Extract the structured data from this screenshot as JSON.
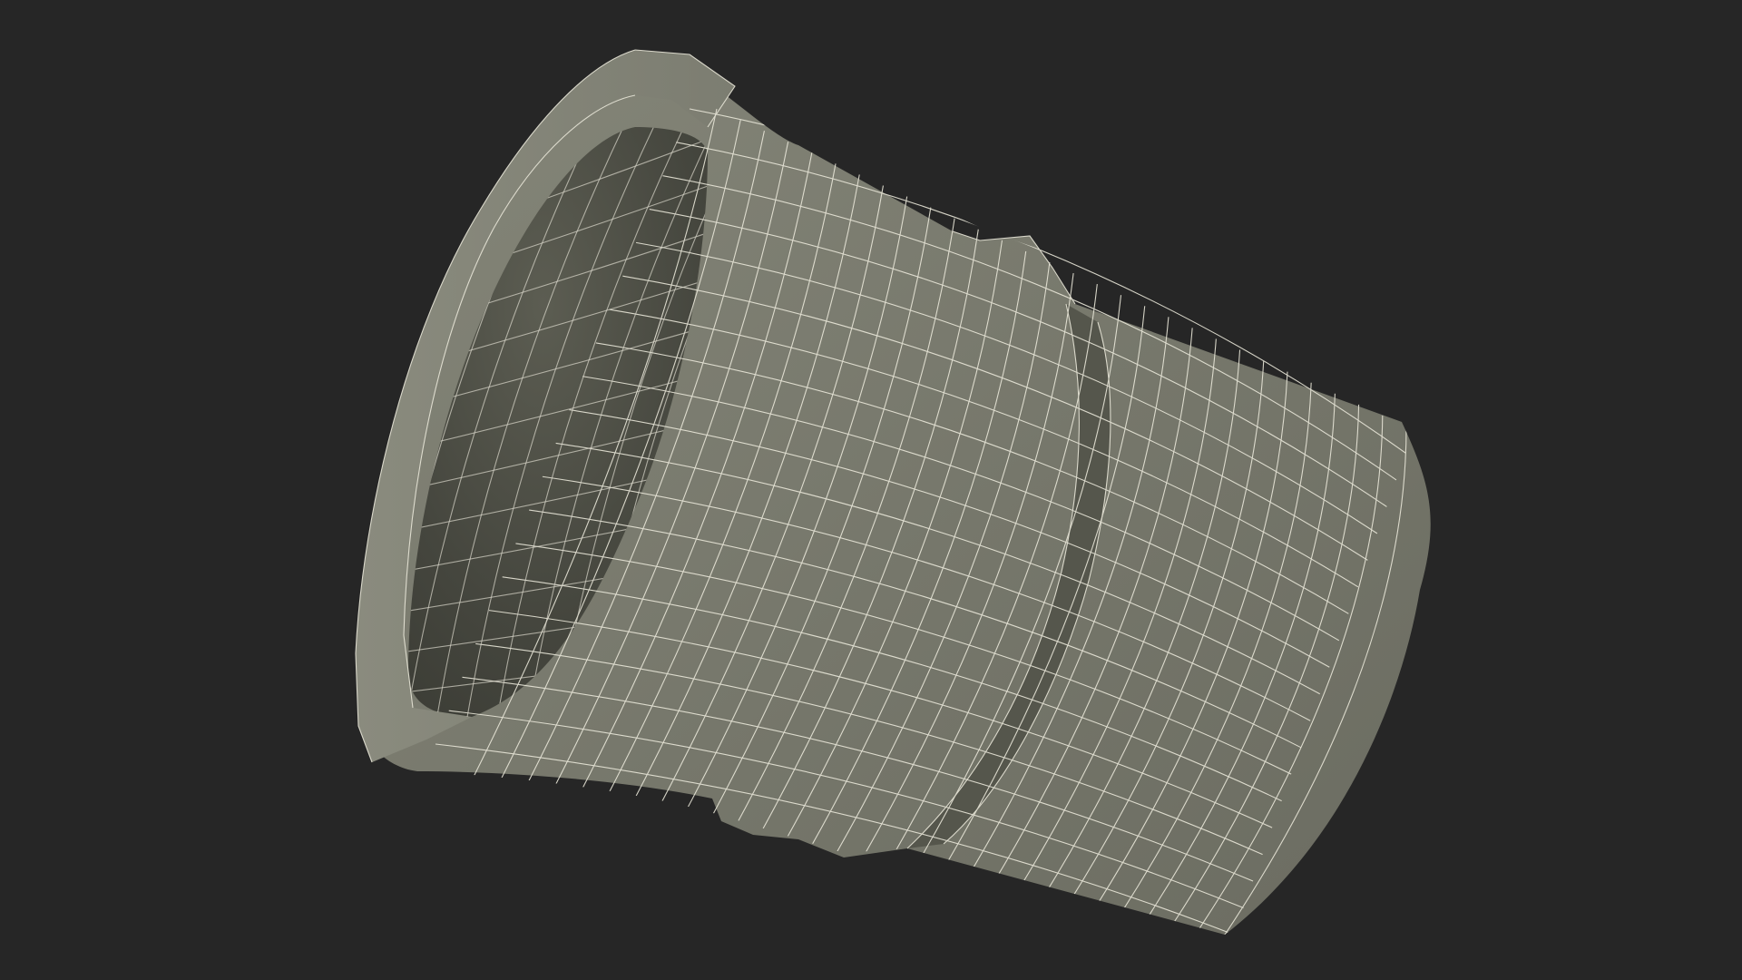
{
  "scene": {
    "background_color": "#262626",
    "object": "bucket-wireframe-render",
    "surface_color": "#7a7b6f",
    "interior_color": "#4a4b42",
    "wire_color": "#e8e6d8",
    "shading": "clay-with-wireframe"
  }
}
